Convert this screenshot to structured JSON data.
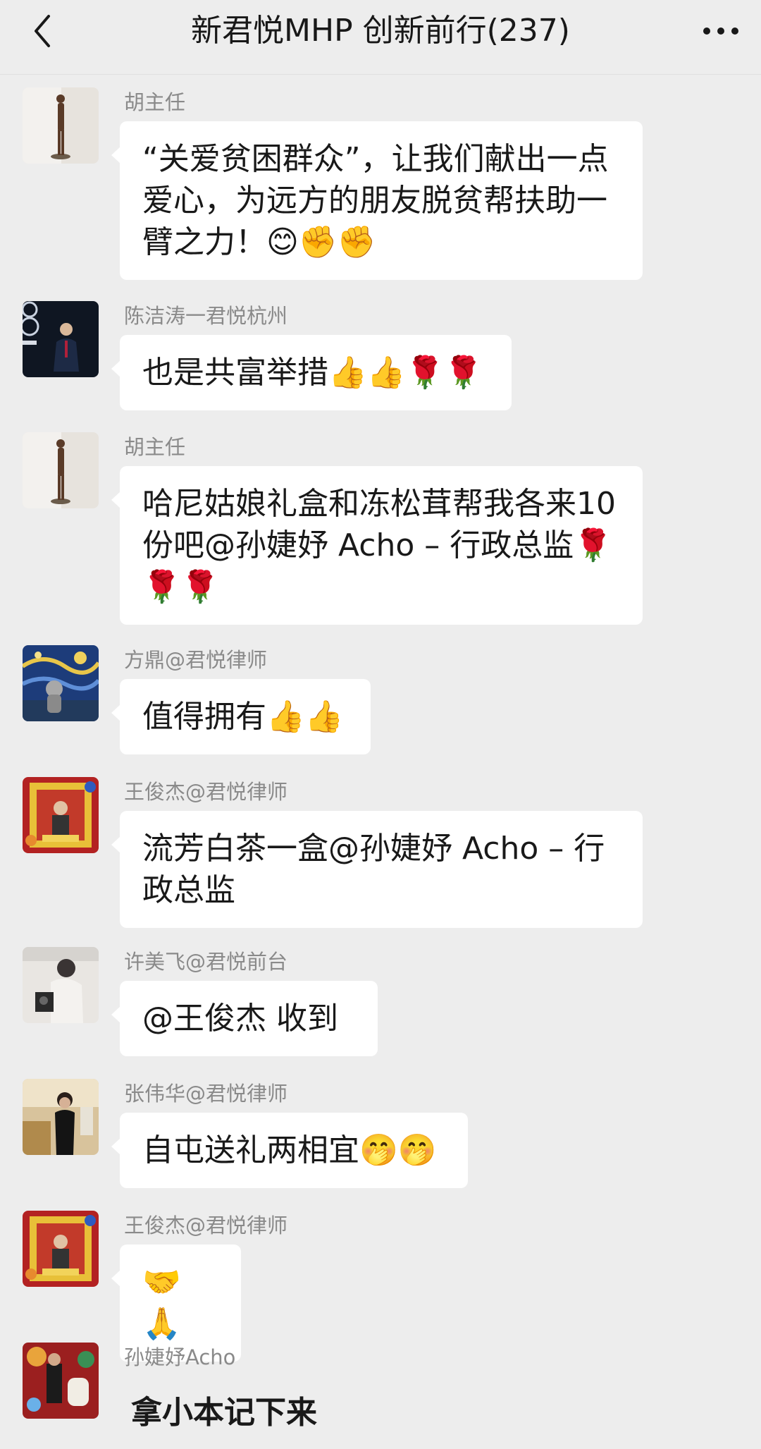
{
  "header": {
    "title": "新君悦MHP 创新前行(237)"
  },
  "messages": [
    {
      "sender": "胡主任",
      "text": "“关爱贫困群众”，让我们献出一点爱心，为远方的朋友脱贫帮扶助一臂之力！😊✊✊"
    },
    {
      "sender": "陈洁涛一君悦杭州",
      "text": "也是共富举措👍👍🌹🌹"
    },
    {
      "sender": "胡主任",
      "text": "哈尼姑娘礼盒和冻松茸帮我各来10份吧@孙婕妤 Acho – 行政总监🌹🌹🌹"
    },
    {
      "sender": "方鼎@君悦律师",
      "text": "值得拥有👍👍"
    },
    {
      "sender": "王俊杰@君悦律师",
      "text": "流芳白茶一盒@孙婕妤 Acho – 行政总监"
    },
    {
      "sender": "许美飞@君悦前台",
      "text": "@王俊杰  收到"
    },
    {
      "sender": "张伟华@君悦律师",
      "text": "自屯送礼两相宜🤭🤭"
    },
    {
      "sender": "王俊杰@君悦律师",
      "text": "🤝🙏"
    },
    {
      "sender": "孙婕妤Acho",
      "text": "拿小本记下来"
    }
  ]
}
